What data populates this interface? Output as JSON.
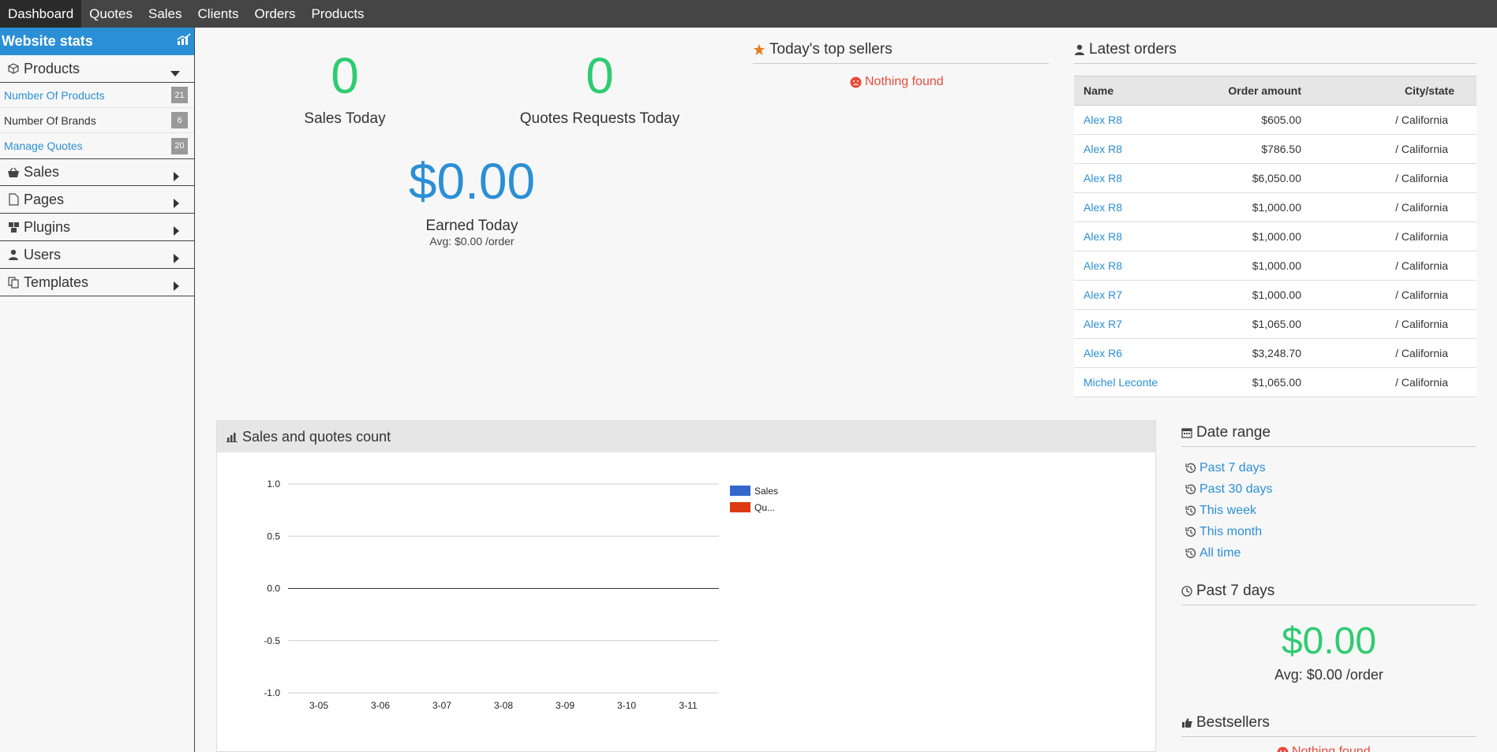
{
  "nav": {
    "items": [
      "Dashboard",
      "Quotes",
      "Sales",
      "Clients",
      "Orders",
      "Products"
    ]
  },
  "sidebar": {
    "title": "Website stats",
    "products_label": "Products",
    "sub_items": [
      {
        "label": "Number Of Products",
        "count": "21"
      },
      {
        "label": "Number Of Brands",
        "count": "6"
      },
      {
        "label": "Manage Quotes",
        "count": "20"
      }
    ],
    "sections": [
      "Sales",
      "Pages",
      "Plugins",
      "Users",
      "Templates"
    ]
  },
  "stats": {
    "sales_today_value": "0",
    "sales_today_label": "Sales Today",
    "quotes_today_value": "0",
    "quotes_today_label": "Quotes Requests Today",
    "earned_value": "$0.00",
    "earned_label": "Earned Today",
    "earned_avg": "Avg: $0.00 /order"
  },
  "top_sellers": {
    "title": "Today's top sellers",
    "empty": "Nothing found"
  },
  "latest_orders": {
    "title": "Latest orders",
    "columns": [
      "Name",
      "Order amount",
      "City/state"
    ],
    "rows": [
      {
        "name": "Alex R8",
        "amount": "$605.00",
        "city": "/ California"
      },
      {
        "name": "Alex R8",
        "amount": "$786.50",
        "city": "/ California"
      },
      {
        "name": "Alex R8",
        "amount": "$6,050.00",
        "city": "/ California"
      },
      {
        "name": "Alex R8",
        "amount": "$1,000.00",
        "city": "/ California"
      },
      {
        "name": "Alex R8",
        "amount": "$1,000.00",
        "city": "/ California"
      },
      {
        "name": "Alex R8",
        "amount": "$1,000.00",
        "city": "/ California"
      },
      {
        "name": "Alex R7",
        "amount": "$1,000.00",
        "city": "/ California"
      },
      {
        "name": "Alex R7",
        "amount": "$1,065.00",
        "city": "/ California"
      },
      {
        "name": "Alex R6",
        "amount": "$3,248.70",
        "city": "/ California"
      },
      {
        "name": "Michel Leconte",
        "amount": "$1,065.00",
        "city": "/ California"
      }
    ]
  },
  "chart_panel": {
    "title": "Sales and quotes count"
  },
  "chart_data": {
    "type": "line",
    "title": "",
    "xlabel": "",
    "ylabel": "",
    "x": [
      "3-05",
      "3-06",
      "3-07",
      "3-08",
      "3-09",
      "3-10",
      "3-11"
    ],
    "y_ticks": [
      "1.0",
      "0.5",
      "0.0",
      "-0.5",
      "-1.0"
    ],
    "ylim": [
      -1.0,
      1.0
    ],
    "grid": true,
    "legend_position": "right",
    "series": [
      {
        "name": "Sales",
        "values": [
          0,
          0,
          0,
          0,
          0,
          0,
          0
        ],
        "color": "#3366cc"
      },
      {
        "name": "Qu...",
        "values": [
          0,
          0,
          0,
          0,
          0,
          0,
          0
        ],
        "color": "#dc3912"
      }
    ]
  },
  "date_range": {
    "title": "Date range",
    "options": [
      "Past 7 days",
      "Past 30 days",
      "This week",
      "This month",
      "All time"
    ]
  },
  "past_period": {
    "title": "Past 7 days",
    "value": "$0.00",
    "avg": "Avg: $0.00 /order"
  },
  "bestsellers": {
    "title": "Bestsellers",
    "empty": "Nothing found"
  },
  "colors": {
    "accent": "#2b8fd6",
    "green": "#2ecc71",
    "red": "#e74c3c",
    "nav_bg": "#454545"
  }
}
